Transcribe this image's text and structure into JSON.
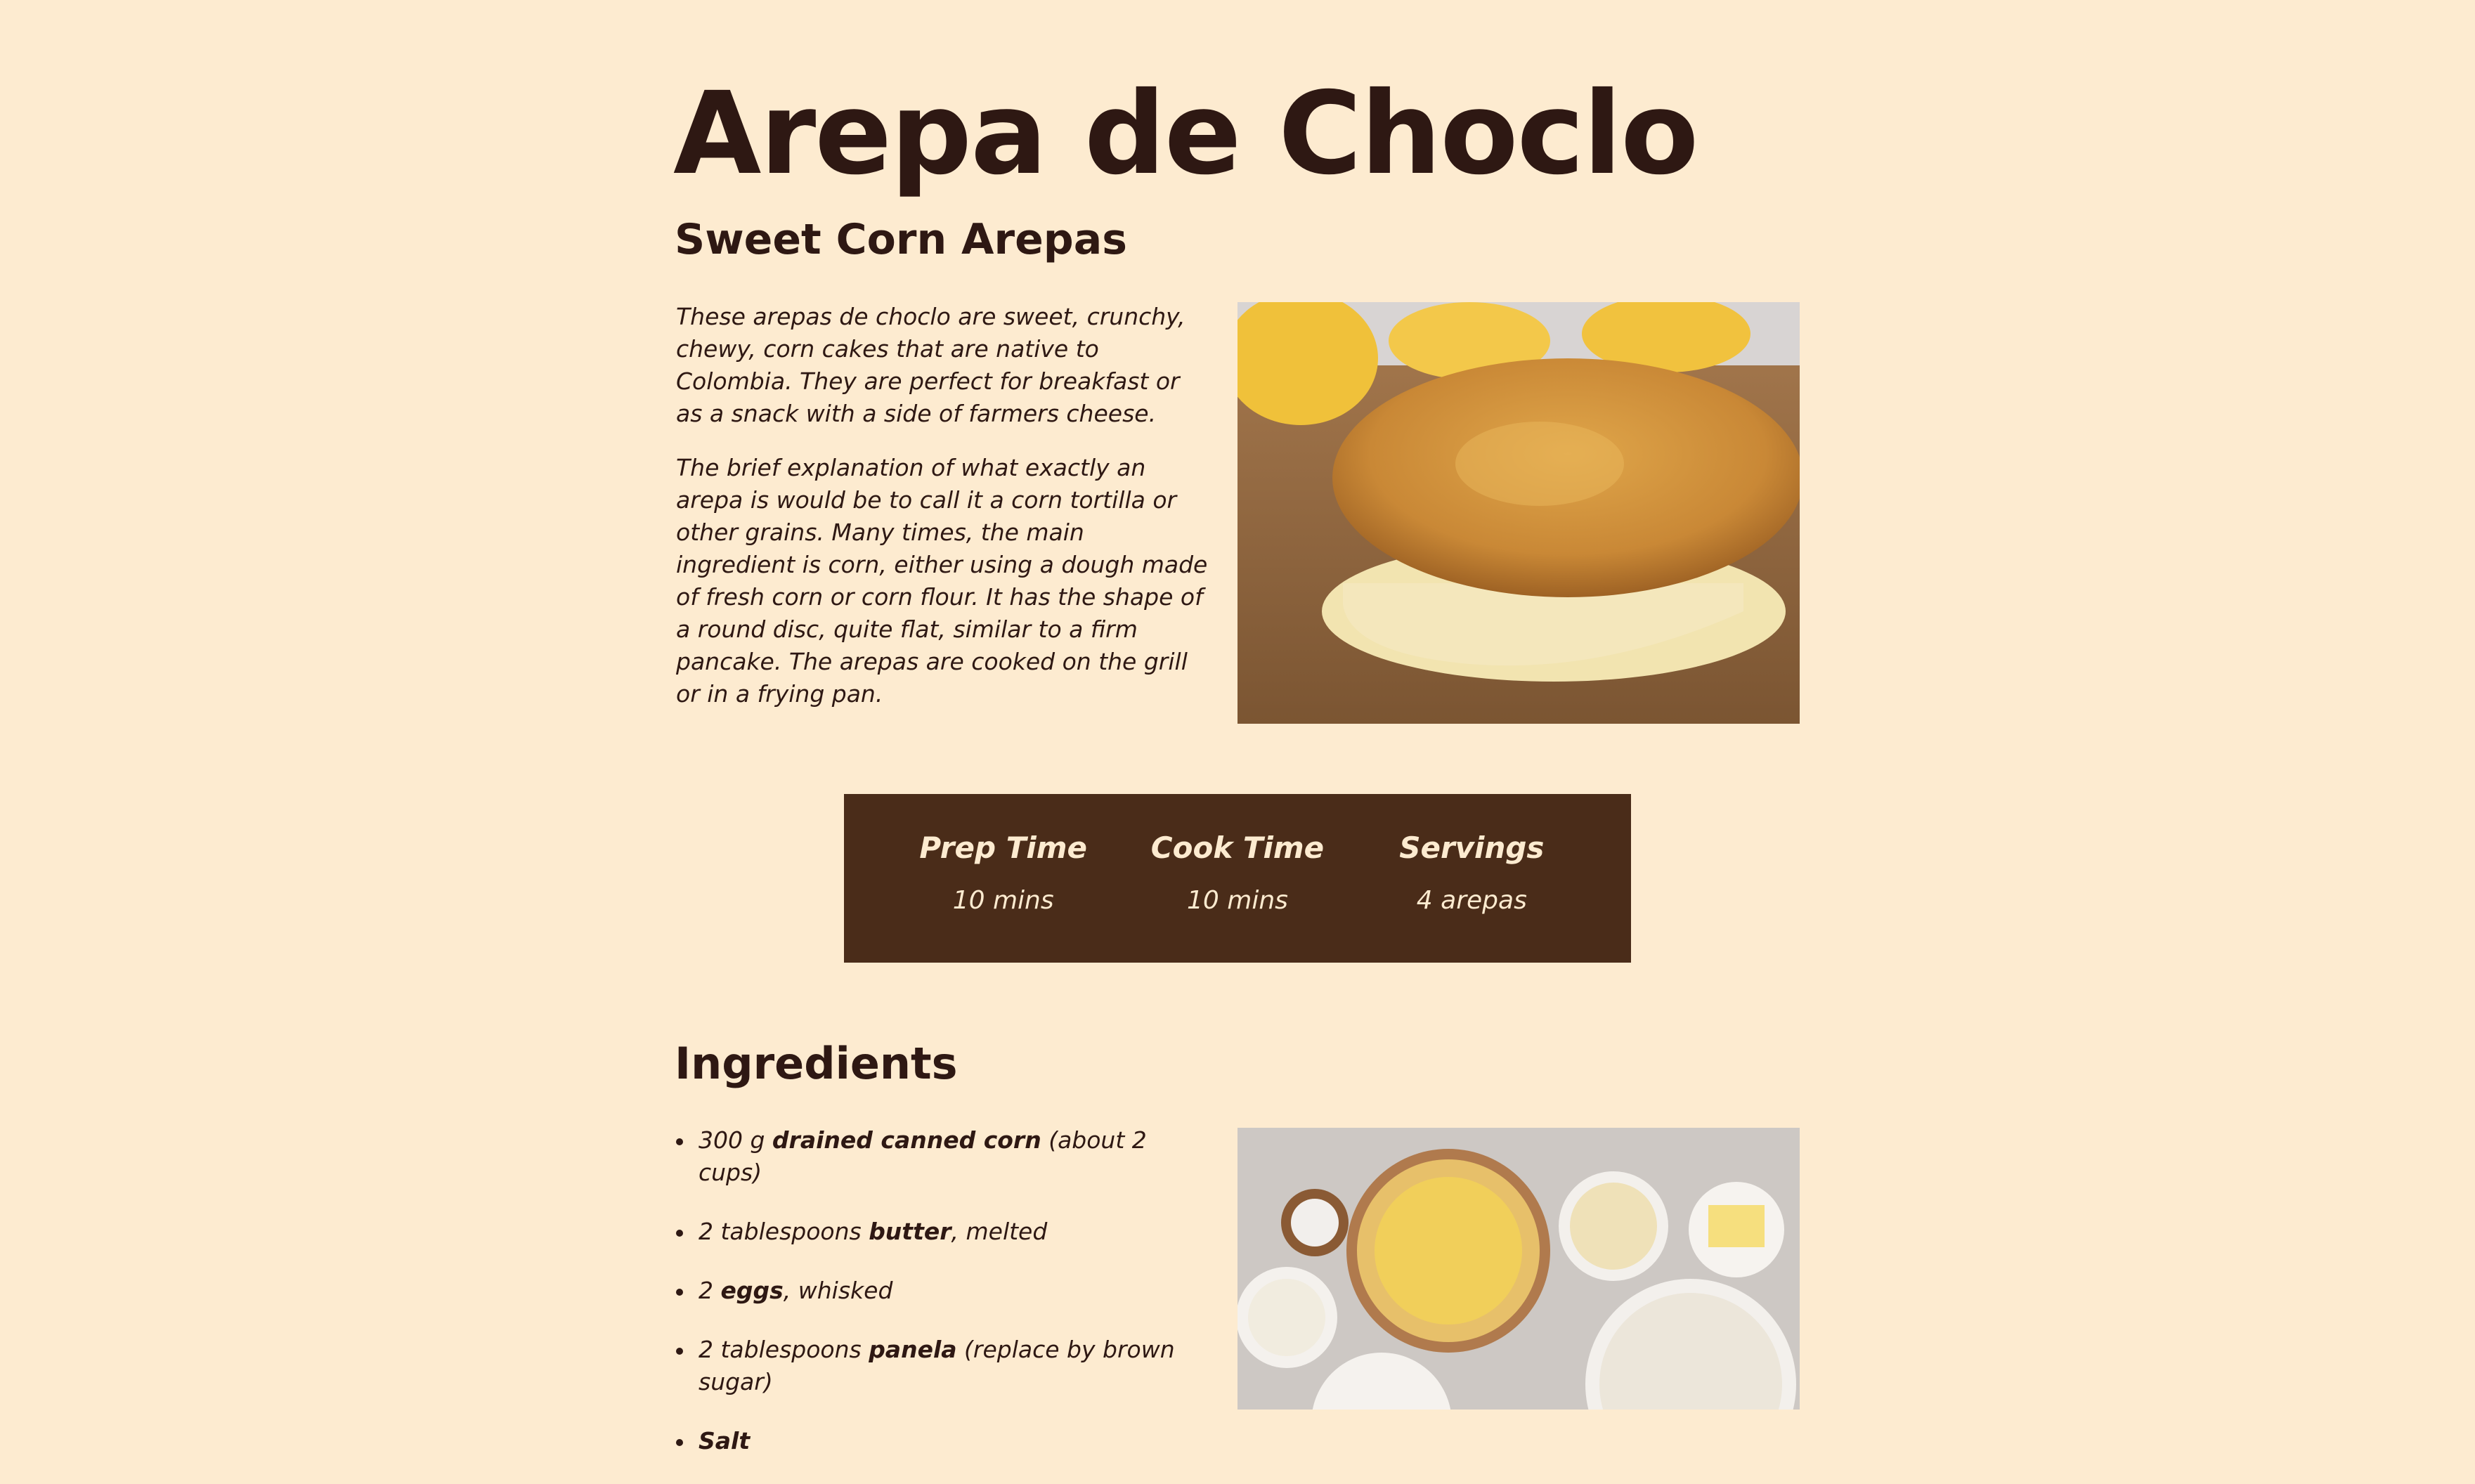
{
  "recipe": {
    "title": "Arepa de Choclo",
    "subtitle": "Sweet Corn Arepas",
    "intro": [
      "These arepas de choclo are sweet, crunchy, chewy, corn cakes that are native to Colombia. They are perfect for breakfast or as a snack with a side of farmers cheese.",
      "The brief explanation of what exactly an arepa is would be to call it a corn tortilla or other grains. Many times, the main ingredient is corn, either using a dough made of fresh corn or corn flour. It has the shape of a round disc, quite flat, similar to a firm pancake. The arepas are cooked on the grill or in a frying pan."
    ]
  },
  "info": {
    "prep_label": "Prep Time",
    "prep_value": "10 mins",
    "cook_label": "Cook Time",
    "cook_value": "10 mins",
    "servings_label": "Servings",
    "servings_value": "4 arepas"
  },
  "ingredients": {
    "heading": "Ingredients",
    "items": [
      {
        "pre": "300 g ",
        "bold": "drained canned corn",
        "post": " (about 2 cups)"
      },
      {
        "pre": "2 tablespoons ",
        "bold": "butter",
        "post": ", melted"
      },
      {
        "pre": "2 ",
        "bold": "eggs",
        "post": ", whisked"
      },
      {
        "pre": "2 tablespoons ",
        "bold": "panela",
        "post": " (replace by brown sugar)"
      },
      {
        "pre": "",
        "bold": "Salt",
        "post": ""
      }
    ]
  },
  "colors": {
    "background": "#fdebd0",
    "text": "#2e1813",
    "info_box": "#4a2c19",
    "info_text": "#fdebd0"
  },
  "images": {
    "hero": "arepa-with-cheese-photo",
    "ingredients": "ingredients-bowls-photo"
  }
}
